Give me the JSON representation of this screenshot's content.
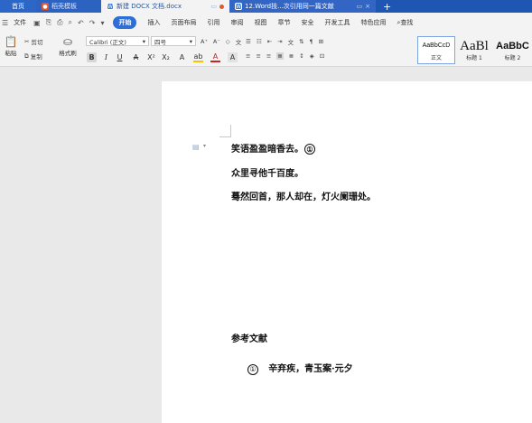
{
  "tabs": {
    "home": "首页",
    "template": "稻壳模板",
    "active_doc": "新建 DOCX 文档.docx",
    "second_doc": "12.Word技...次引用同一篇文献",
    "new_tab": "+"
  },
  "menu": {
    "file": "文件",
    "start": "开始",
    "items": [
      "插入",
      "页面布局",
      "引用",
      "审阅",
      "视图",
      "章节",
      "安全",
      "开发工具",
      "特色应用"
    ],
    "search": "查找"
  },
  "ribbon": {
    "paste": "粘贴",
    "cut": "剪切",
    "copy": "复制",
    "format_painter": "格式刷",
    "font_name": "Calibri (正文)",
    "font_size": "四号",
    "styles": [
      {
        "sample": "AaBbCcD",
        "caption": "正文"
      },
      {
        "sample": "AaBl",
        "caption": "标题 1"
      },
      {
        "sample": "AaBbC",
        "caption": "标题 2"
      }
    ]
  },
  "document": {
    "line1": "笑语盈盈暗香去。",
    "line1_note": "①",
    "line2": "众里寻他千百度。",
    "line3": "蓦然回首，那人却在，灯火阑珊处。",
    "references_heading": "参考文献",
    "footnote_marker": "①",
    "footnote_text": "辛弃疾，青玉案·元夕"
  }
}
